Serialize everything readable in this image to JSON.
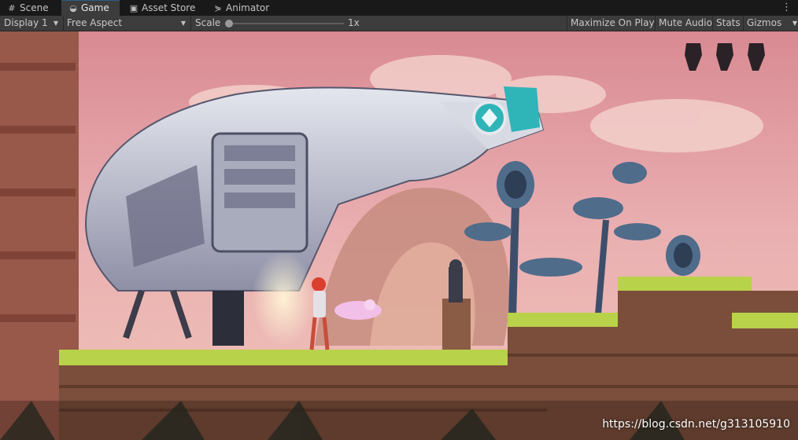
{
  "tabs": [
    {
      "label": "Scene",
      "icon": "grid-icon"
    },
    {
      "label": "Game",
      "icon": "gamepad-icon"
    },
    {
      "label": "Asset Store",
      "icon": "shopping-bag-icon"
    },
    {
      "label": "Animator",
      "icon": "animator-icon"
    }
  ],
  "active_tab": "Game",
  "toolbar": {
    "display": "Display 1",
    "aspect": "Free Aspect",
    "scale_label": "Scale",
    "scale_value": "1x",
    "maximize": "Maximize On Play",
    "mute": "Mute Audio",
    "stats": "Stats",
    "gizmos": "Gizmos"
  },
  "watermark": "https://blog.csdn.net/g313105910",
  "colors": {
    "accent": "#2c5d87",
    "sky": "#e8a3a8",
    "grass": "#b8d24a",
    "ship": "#c9ccd6",
    "ship_accent": "#2fb4b8"
  }
}
